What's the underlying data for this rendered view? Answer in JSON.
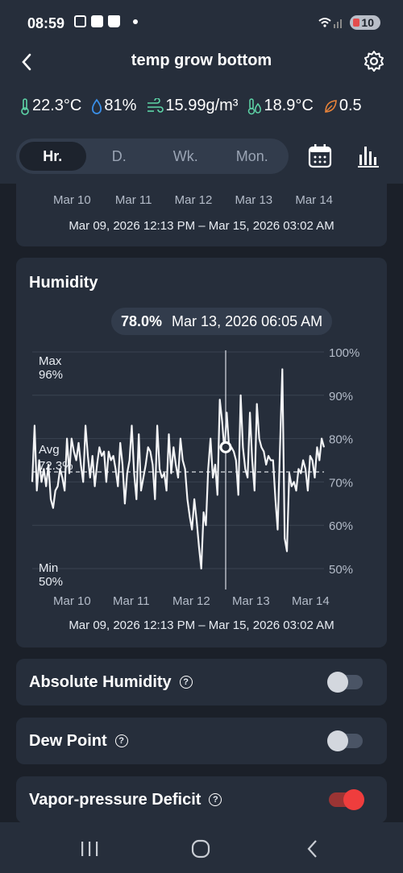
{
  "status": {
    "time": "08:59",
    "battery": "10"
  },
  "header": {
    "title": "temp grow bottom"
  },
  "metrics": [
    {
      "icon": "thermometer-icon",
      "value": "22.3°C",
      "color": "#5ed6a8"
    },
    {
      "icon": "droplet-icon",
      "value": "81%",
      "color": "#3a8fe8"
    },
    {
      "icon": "wind-icon",
      "value": "15.99g/m³",
      "color": "#5ed6a8"
    },
    {
      "icon": "dew-point-icon",
      "value": "18.9°C",
      "color": "#5ed6a8"
    },
    {
      "icon": "leaf-icon",
      "value": "0.5",
      "color": "#e8833a"
    }
  ],
  "tabs": [
    {
      "label": "Hr.",
      "active": true
    },
    {
      "label": "D.",
      "active": false
    },
    {
      "label": "Wk.",
      "active": false
    },
    {
      "label": "Mon.",
      "active": false
    }
  ],
  "prev_card": {
    "x_ticks": [
      "Mar 10",
      "Mar 11",
      "Mar 12",
      "Mar 13",
      "Mar 14"
    ],
    "range": "Mar 09, 2026 12:13 PM – Mar 15, 2026 03:02 AM"
  },
  "humidity_card": {
    "title": "Humidity",
    "tooltip_value": "78.0%",
    "tooltip_time": "Mar 13, 2026 06:05 AM",
    "max_label": "Max",
    "max_value": "96%",
    "avg_label": "Avg",
    "avg_value": "72.3%",
    "min_label": "Min",
    "min_value": "50%",
    "range": "Mar 09, 2026 12:13 PM – Mar 15, 2026 03:02 AM"
  },
  "chart_data": {
    "type": "line",
    "title": "Humidity",
    "x_ticks": [
      "Mar 10",
      "Mar 11",
      "Mar 12",
      "Mar 13",
      "Mar 14"
    ],
    "y_ticks": [
      "50%",
      "60%",
      "70%",
      "80%",
      "90%",
      "100%"
    ],
    "ylim": [
      50,
      100
    ],
    "avg": 72.3,
    "max": 96,
    "min": 50,
    "series": [
      {
        "values": [
          70,
          83,
          68,
          75,
          70,
          73,
          69,
          74,
          66,
          64,
          68,
          69,
          73,
          71,
          68,
          80,
          72,
          80,
          77,
          75,
          79,
          74,
          70,
          83,
          76,
          71,
          76,
          69,
          74,
          78,
          76,
          77,
          70,
          77,
          75,
          76,
          73,
          69,
          79,
          74,
          65,
          72,
          75,
          83,
          72,
          66,
          81,
          68,
          71,
          74,
          78,
          77,
          74,
          66,
          83,
          73,
          71,
          72,
          68,
          81,
          72,
          78,
          74,
          71,
          80,
          75,
          73,
          66,
          62,
          59,
          66,
          61,
          55,
          50,
          63,
          60,
          73,
          80,
          71,
          74,
          67,
          89,
          84,
          77,
          86,
          78,
          78,
          77,
          75,
          67,
          90,
          78,
          73,
          71,
          86,
          75,
          68,
          88,
          80,
          78,
          77,
          74,
          76,
          75,
          75,
          66,
          59,
          78,
          96,
          57,
          54,
          72,
          69,
          70,
          68,
          73,
          72,
          75,
          73,
          68,
          76,
          75,
          71,
          78,
          75,
          80,
          78
        ],
        "highlight": {
          "value": 78.0,
          "label": "Mar 13, 2026 06:05 AM"
        }
      }
    ],
    "grid": true
  },
  "toggles": [
    {
      "label": "Absolute Humidity",
      "on": false
    },
    {
      "label": "Dew Point",
      "on": false
    },
    {
      "label": "Vapor-pressure Deficit",
      "on": true
    }
  ]
}
